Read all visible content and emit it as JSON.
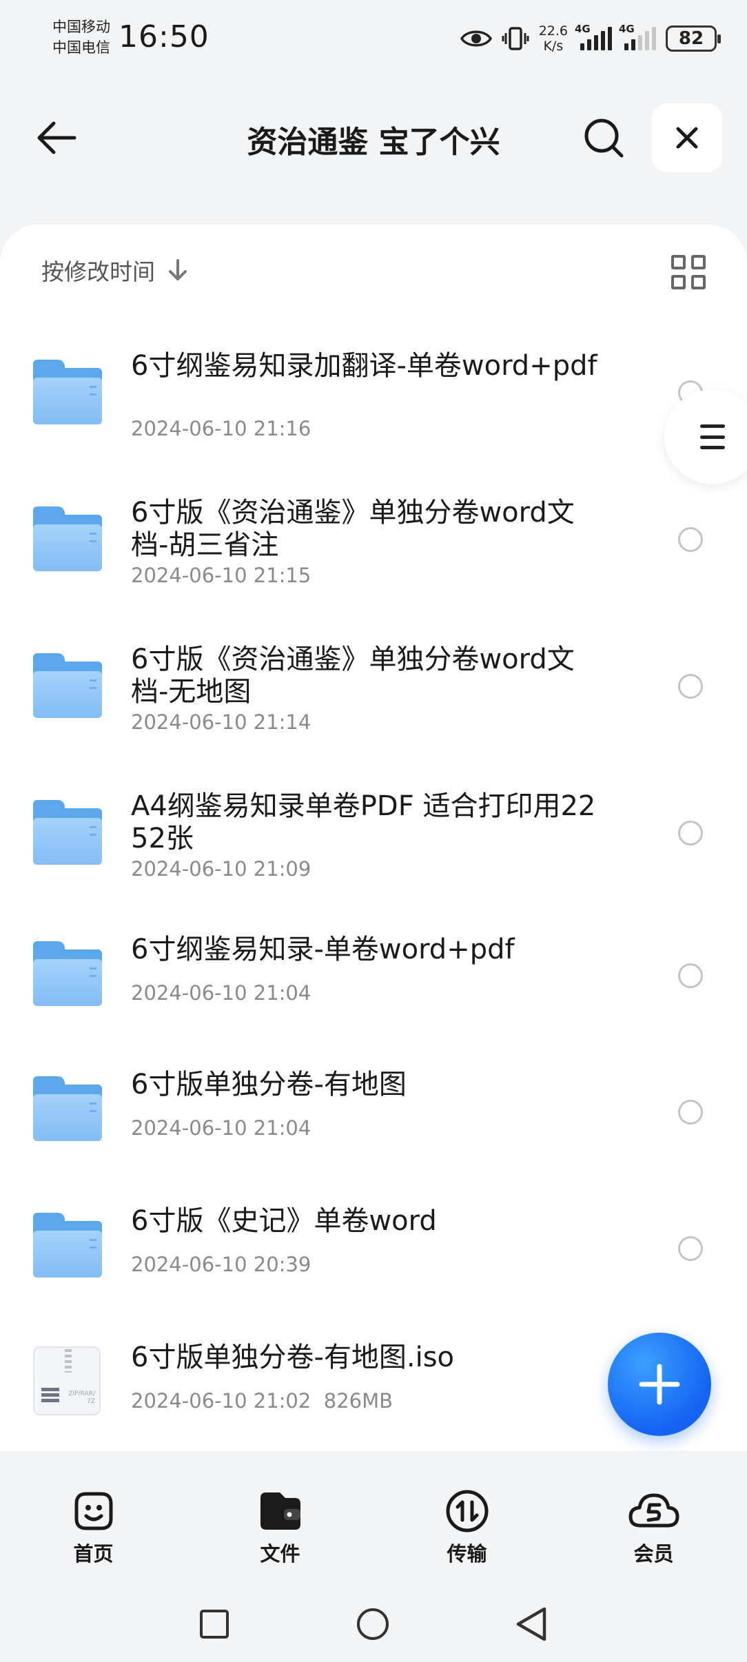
{
  "status_bar": {
    "carrier1": "中国移动",
    "carrier2": "中国电信",
    "time": "16:50",
    "net_speed_value": "22.6",
    "net_speed_unit": "K/s",
    "sim1_tag": "4G",
    "sim2_tag": "4G",
    "battery": "82"
  },
  "header": {
    "title": "资治通鉴 宝了个兴"
  },
  "sort": {
    "label": "按修改时间"
  },
  "files": [
    {
      "name": "6寸纲鉴易知录加翻译-单卷word+pdf",
      "date": "2024-06-10 21:16",
      "type": "folder"
    },
    {
      "name": "6寸版《资治通鉴》单独分卷word文档-胡三省注",
      "date": "2024-06-10 21:15",
      "type": "folder"
    },
    {
      "name": "6寸版《资治通鉴》单独分卷word文档-无地图",
      "date": "2024-06-10 21:14",
      "type": "folder"
    },
    {
      "name": "A4纲鉴易知录单卷PDF 适合打印用2252张",
      "date": "2024-06-10 21:09",
      "type": "folder"
    },
    {
      "name": "6寸纲鉴易知录-单卷word+pdf",
      "date": "2024-06-10 21:04",
      "type": "folder"
    },
    {
      "name": "6寸版单独分卷-有地图",
      "date": "2024-06-10 21:04",
      "type": "folder"
    },
    {
      "name": "6寸版《史记》单卷word",
      "date": "2024-06-10 20:39",
      "type": "folder"
    },
    {
      "name": "6寸版单独分卷-有地图.iso",
      "date": "2024-06-10 21:02",
      "size": "826MB",
      "type": "archive"
    }
  ],
  "archive_icon_text": "ZIP/RAR/\n7Z",
  "bottom_nav": [
    {
      "label": "首页",
      "icon": "smiley-icon"
    },
    {
      "label": "文件",
      "icon": "wallet-folder-icon"
    },
    {
      "label": "传输",
      "icon": "transfer-icon"
    },
    {
      "label": "会员",
      "icon": "cloud-vip-icon"
    }
  ],
  "colors": {
    "accent": "#1463f2",
    "folder": "#83bdf4"
  }
}
